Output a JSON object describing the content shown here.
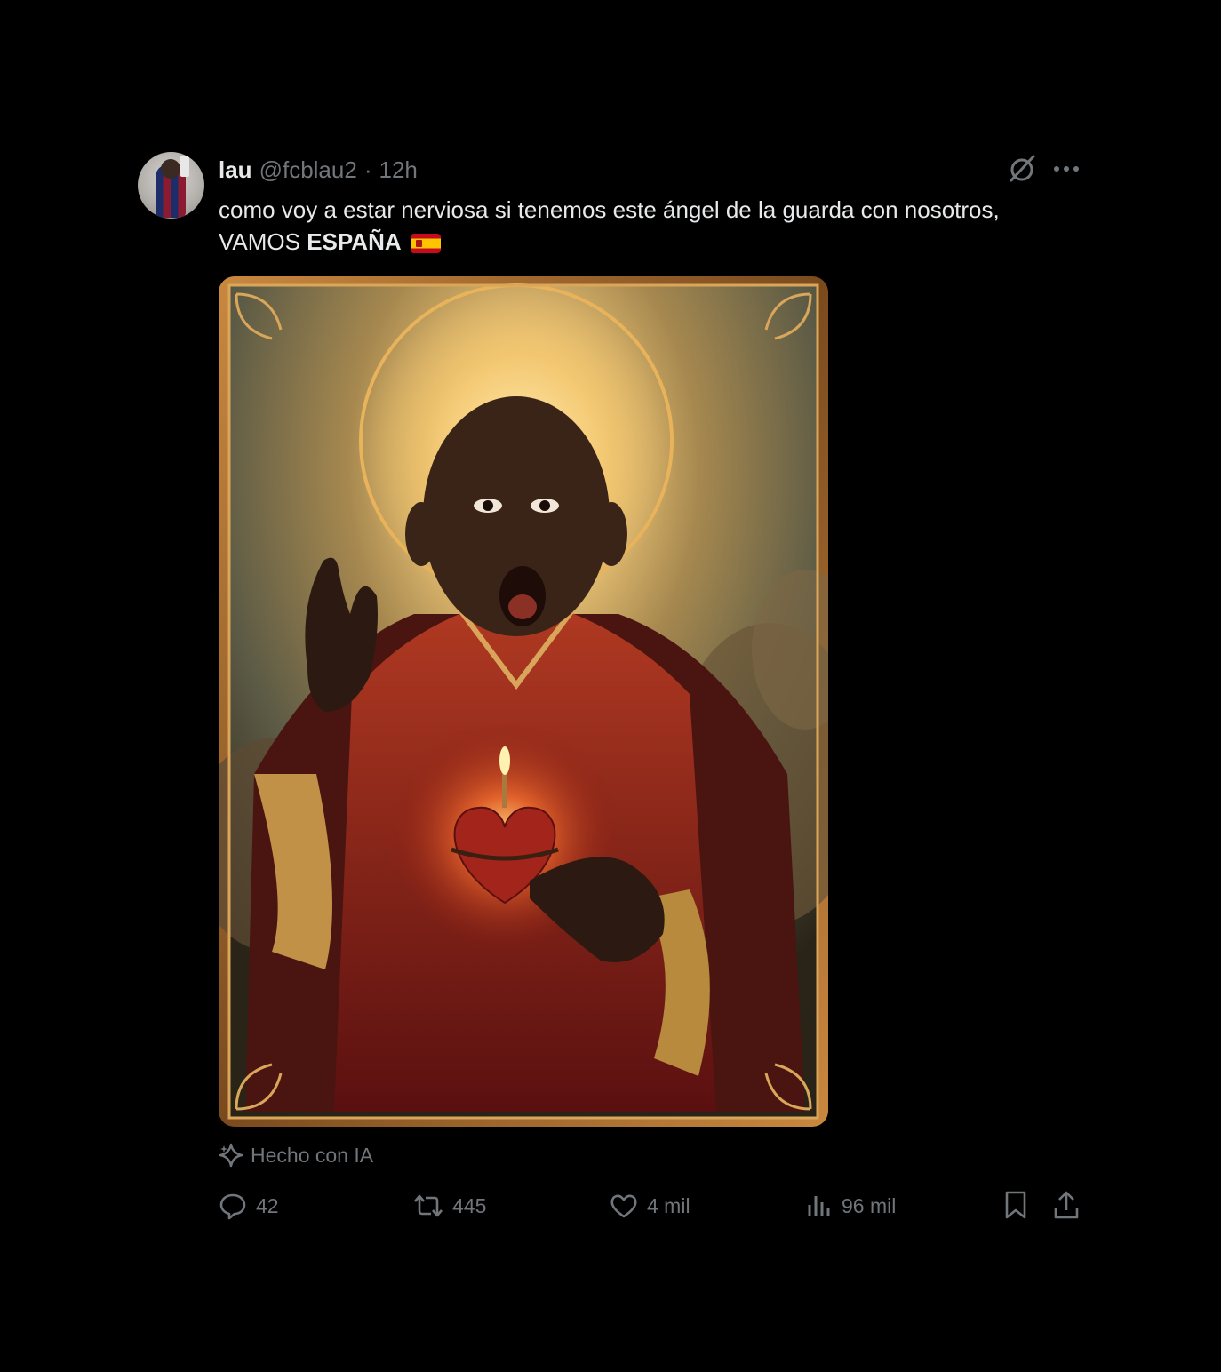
{
  "post": {
    "author": {
      "name": "lau",
      "handle": "@fcblau2"
    },
    "time": "12h",
    "separator": "·",
    "text": {
      "line1": "como voy a estar nerviosa si tenemos este ángel de la guarda con nosotros,",
      "line2_prefix": "VAMOS ",
      "line2_bold": "ESPAÑA",
      "flag_icon": "spain-flag-icon"
    },
    "media_label": "Hecho con IA",
    "stats": {
      "replies": "42",
      "reposts": "445",
      "likes": "4 mil",
      "views": "96 mil"
    }
  },
  "icons": {
    "grok": "grok-icon",
    "more": "more-icon",
    "ai": "sparkle-icon",
    "reply": "reply-icon",
    "repost": "repost-icon",
    "like": "heart-icon",
    "views": "bar-chart-icon",
    "bookmark": "bookmark-icon",
    "share": "share-icon"
  },
  "colors": {
    "background": "#000000",
    "text": "#e7e9ea",
    "secondary": "#71767b"
  }
}
